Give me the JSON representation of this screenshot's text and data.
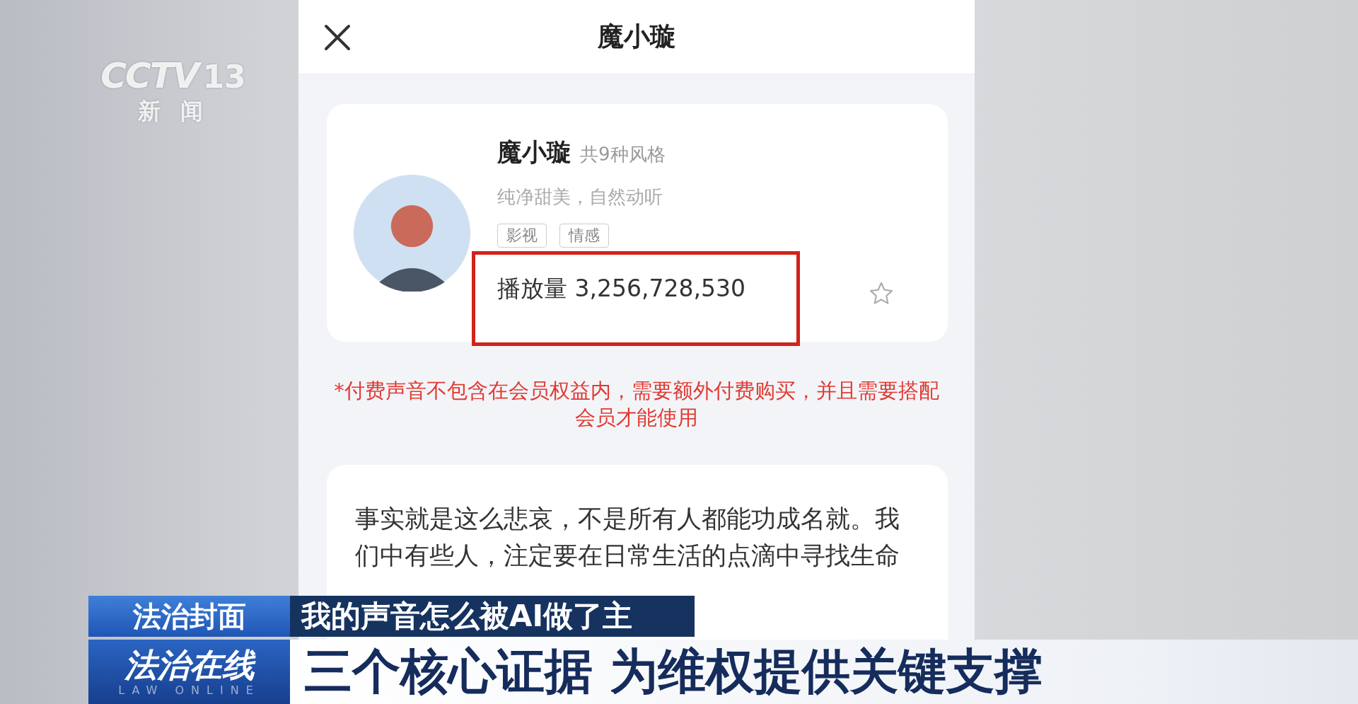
{
  "channel_logo": {
    "name": "CCTV",
    "number": "13",
    "subtitle": "新 闻"
  },
  "header": {
    "title": "魔小璇"
  },
  "voice_card": {
    "name": "魔小璇",
    "style_count": "共9种风格",
    "description": "纯净甜美，自然动听",
    "tags": [
      "影视",
      "情感"
    ],
    "play_label": "播放量",
    "play_count": "3,256,728,530",
    "highlighted": true,
    "favorited": false
  },
  "notice": "*付费声音不包含在会员权益内，需要额外付费购买，并且需要搭配会员才能使用",
  "sample_text": "事实就是这么悲哀，不是所有人都能功成名就。我们中有些人，注定要在日常生活的点滴中寻找生命",
  "lower_third": {
    "section": "法治封面",
    "headline": "我的声音怎么被AI做了主",
    "program": "法治在线",
    "program_en": "LAW ONLINE",
    "caption": "三个核心证据 为维权提供关键支撑"
  }
}
